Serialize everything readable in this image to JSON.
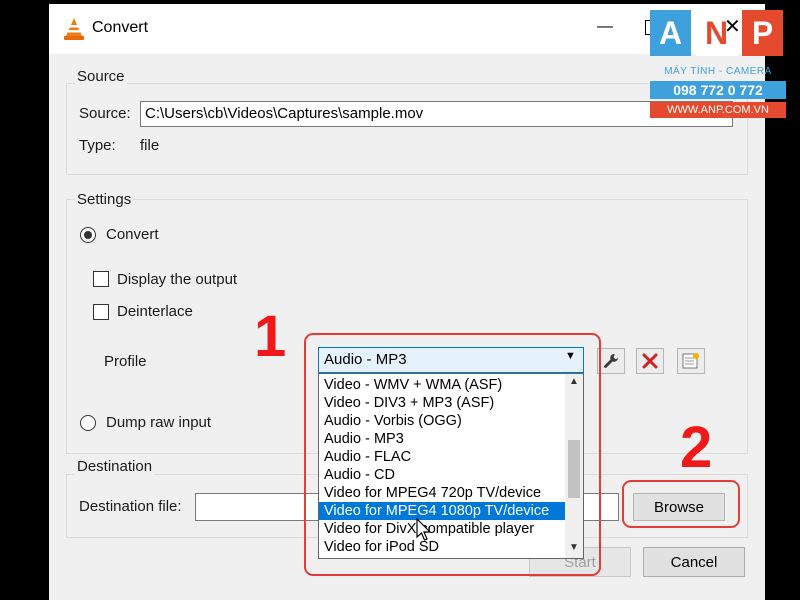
{
  "window": {
    "title": "Convert",
    "controls": [
      "minimize",
      "maximize",
      "close"
    ]
  },
  "source": {
    "group_label": "Source",
    "source_label": "Source:",
    "source_value": "C:\\Users\\cb\\Videos\\Captures\\sample.mov",
    "type_label": "Type:",
    "type_value": "file"
  },
  "settings": {
    "group_label": "Settings",
    "convert_label": "Convert",
    "convert_selected": true,
    "display_output_label": "Display the output",
    "display_output_checked": false,
    "deinterlace_label": "Deinterlace",
    "deinterlace_checked": false,
    "profile_label": "Profile",
    "profile_selected": "Audio - MP3",
    "dump_raw_label": "Dump raw input",
    "dump_raw_selected": false,
    "profile_options": [
      "Video - WMV + WMA (ASF)",
      "Video - DIV3 + MP3 (ASF)",
      "Audio - Vorbis (OGG)",
      "Audio - MP3",
      "Audio - FLAC",
      "Audio - CD",
      "Video for MPEG4 720p TV/device",
      "Video for MPEG4 1080p TV/device",
      "Video for DivX compatible player",
      "Video for iPod SD"
    ],
    "highlighted_option": "Video for MPEG4 1080p TV/device"
  },
  "destination": {
    "group_label": "Destination",
    "file_label": "Destination file:",
    "file_value": "",
    "browse_label": "Browse"
  },
  "footer": {
    "start_label": "Start",
    "cancel_label": "Cancel"
  },
  "annotations": {
    "step1": "1",
    "step2": "2",
    "color": "#e43b3b"
  },
  "watermark": {
    "letters": [
      "A",
      "N",
      "P"
    ],
    "line1": "MÁY TÍNH - CAMERA",
    "line2": "098 772 0 772",
    "line3": "WWW.ANP.COM.VN",
    "colors": [
      "#3ea0dc",
      "#e64a2e"
    ]
  }
}
